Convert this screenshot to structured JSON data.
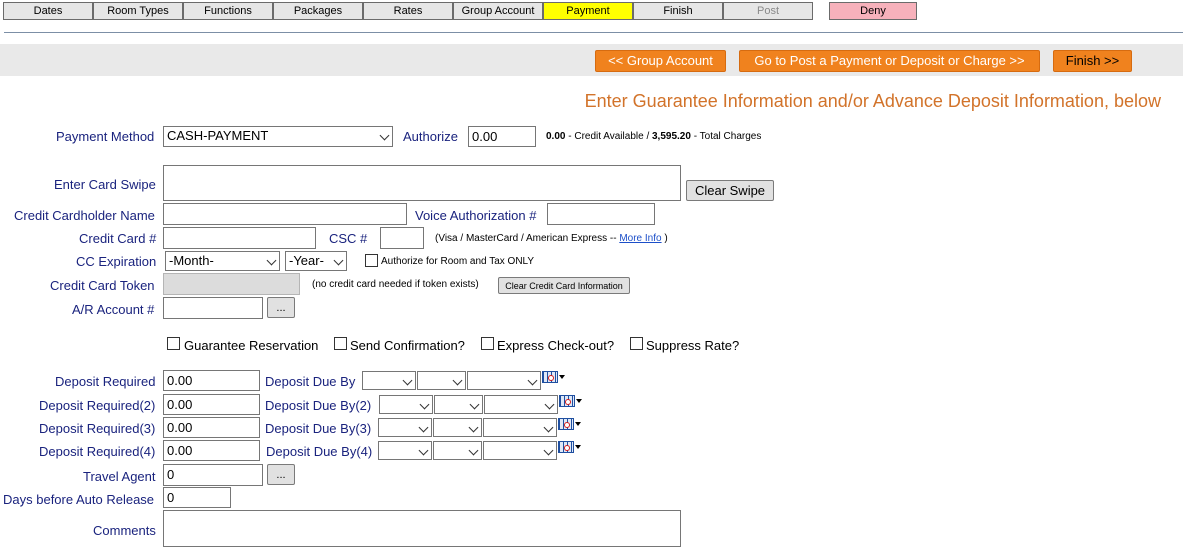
{
  "tabs": [
    {
      "label": "Dates"
    },
    {
      "label": "Room Types"
    },
    {
      "label": "Functions"
    },
    {
      "label": "Packages"
    },
    {
      "label": "Rates"
    },
    {
      "label": "Group Account"
    },
    {
      "label": "Payment"
    },
    {
      "label": "Finish"
    },
    {
      "label": "Post"
    },
    {
      "label": "Deny"
    }
  ],
  "toolbar": {
    "back_label": "<< Group Account",
    "post_label": "Go to Post a Payment or Deposit or Charge >>",
    "finish_label": "Finish >>"
  },
  "heading": "Enter Guarantee Information and/or Advance Deposit Information, below",
  "payment": {
    "method_label": "Payment Method",
    "method_value": "CASH-PAYMENT",
    "authorize_label": "Authorize",
    "authorize_value": "0.00",
    "credit_available_value": "0.00",
    "credit_available_text": "- Credit Available  /",
    "total_charges_value": "3,595.20",
    "total_charges_text": "- Total Charges"
  },
  "card": {
    "swipe_label": "Enter Card Swipe",
    "clear_swipe_label": "Clear Swipe",
    "cardholder_label": "Credit Cardholder Name",
    "voice_auth_label": "Voice Authorization #",
    "card_number_label": "Credit Card #",
    "csc_label": "CSC #",
    "card_types_text": "(Visa / MasterCard / American Express --",
    "more_info_label": " More Info",
    "card_types_close": ")",
    "expiration_label": "CC Expiration",
    "month_value": "-Month-",
    "year_value": "-Year-",
    "authorize_room_tax_label": "Authorize for Room and Tax ONLY",
    "token_label": "Credit Card Token",
    "token_note": "(no credit card needed if token exists)",
    "clear_card_label": "Clear Credit Card Information",
    "ar_label": "A/R Account #",
    "ellipsis_label": "..."
  },
  "options": {
    "guarantee_label": "Guarantee Reservation",
    "send_confirmation_label": "Send Confirmation?",
    "express_checkout_label": "Express Check-out?",
    "suppress_rate_label": "Suppress Rate?"
  },
  "deposits": [
    {
      "label": "Deposit Required",
      "value": "0.00",
      "due_label": "Deposit Due By"
    },
    {
      "label": "Deposit Required(2)",
      "value": "0.00",
      "due_label": "Deposit Due By(2)"
    },
    {
      "label": "Deposit Required(3)",
      "value": "0.00",
      "due_label": "Deposit Due By(3)"
    },
    {
      "label": "Deposit Required(4)",
      "value": "0.00",
      "due_label": "Deposit Due By(4)"
    }
  ],
  "travel_agent": {
    "label": "Travel Agent",
    "value": "0",
    "ellipsis_label": "..."
  },
  "auto_release": {
    "label": "Days before Auto Release",
    "value": "0"
  },
  "comments": {
    "label": "Comments",
    "value": ""
  },
  "icons": {
    "calendar": "calendar-icon",
    "dropdown": "chevron-down-icon"
  },
  "colors": {
    "accent_orange": "#f0821e",
    "heading_orange": "#d2732a",
    "label_navy": "#1a237e",
    "active_tab": "#ffff00",
    "deny_tab": "#f7b1bb"
  }
}
